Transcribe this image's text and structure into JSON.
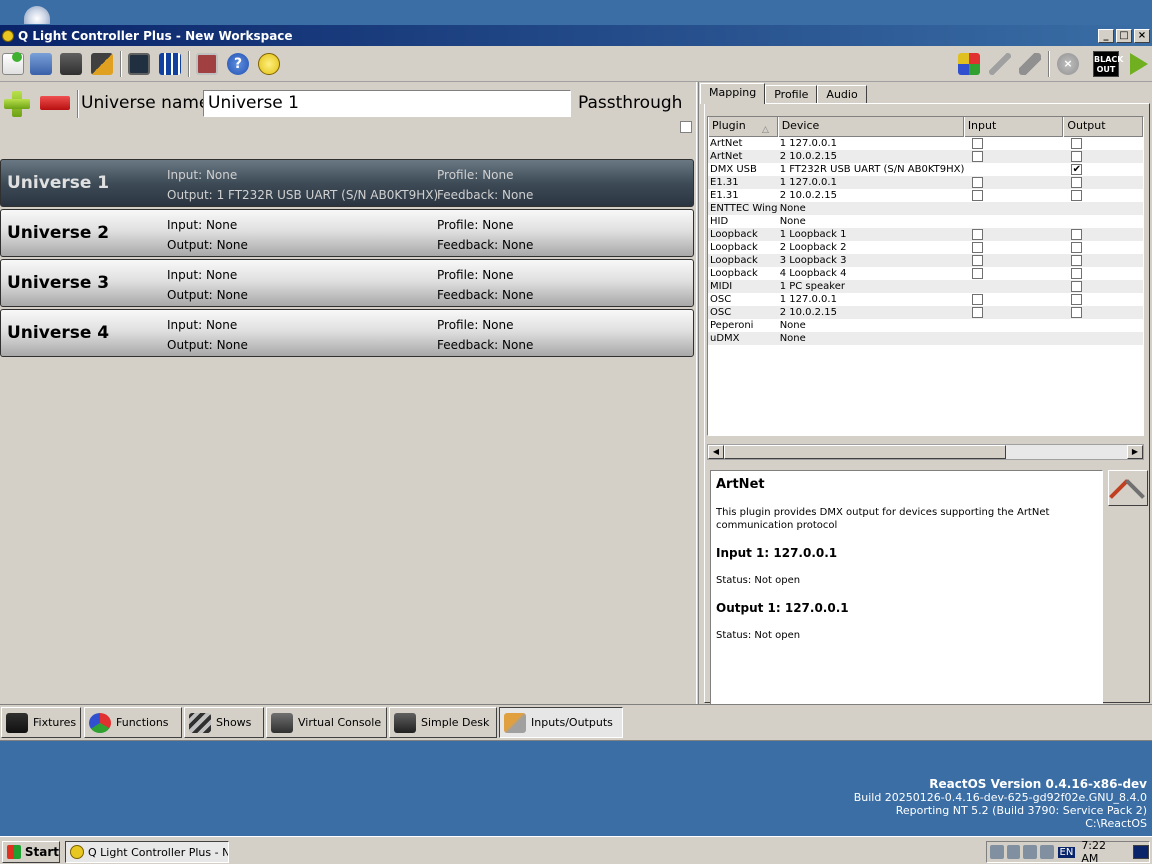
{
  "window": {
    "title": "Q Light Controller Plus - New Workspace"
  },
  "toolbar": {
    "left_icons": [
      "new-workspace-icon",
      "open-icon",
      "save-icon",
      "save-as-icon",
      "monitor-icon",
      "address-tool-icon",
      "dump-icon",
      "help-icon",
      "about-icon"
    ],
    "right_icons": [
      "fixture-edit-icon",
      "fade-icon",
      "stop-icon",
      "black-out",
      "play-icon"
    ],
    "blackout_label_1": "BLACK",
    "blackout_label_2": "OUT"
  },
  "universe_toolbar": {
    "name_label": "Universe name:",
    "name_value": "Universe 1",
    "passthrough_label": "Passthrough"
  },
  "universes": [
    {
      "name": "Universe 1",
      "input_label": "Input:",
      "input": "None",
      "output_label": "Output:",
      "output": "1 FT232R USB UART (S/N AB0KT9HX)",
      "profile_label": "Profile:",
      "profile": "None",
      "feedback_label": "Feedback:",
      "feedback": "None",
      "selected": true
    },
    {
      "name": "Universe 2",
      "input_label": "Input:",
      "input": "None",
      "output_label": "Output:",
      "output": "None",
      "profile_label": "Profile:",
      "profile": "None",
      "feedback_label": "Feedback:",
      "feedback": "None",
      "selected": false
    },
    {
      "name": "Universe 3",
      "input_label": "Input:",
      "input": "None",
      "output_label": "Output:",
      "output": "None",
      "profile_label": "Profile:",
      "profile": "None",
      "feedback_label": "Feedback:",
      "feedback": "None",
      "selected": false
    },
    {
      "name": "Universe 4",
      "input_label": "Input:",
      "input": "None",
      "output_label": "Output:",
      "output": "None",
      "profile_label": "Profile:",
      "profile": "None",
      "feedback_label": "Feedback:",
      "feedback": "None",
      "selected": false
    }
  ],
  "right_tabs": [
    {
      "label": "Mapping",
      "active": true
    },
    {
      "label": "Profile",
      "active": false
    },
    {
      "label": "Audio",
      "active": false
    }
  ],
  "mapping": {
    "headers": [
      "Plugin",
      "Device",
      "Input",
      "Output"
    ],
    "rows": [
      {
        "plugin": "ArtNet",
        "device": "1  127.0.0.1",
        "input": "unchecked",
        "output": "unchecked"
      },
      {
        "plugin": "ArtNet",
        "device": "2  10.0.2.15",
        "input": "unchecked",
        "output": "unchecked"
      },
      {
        "plugin": "DMX USB",
        "device": "1  FT232R USB UART (S/N AB0KT9HX)",
        "input": "",
        "output": "checked"
      },
      {
        "plugin": "E1.31",
        "device": "1  127.0.0.1",
        "input": "unchecked",
        "output": "unchecked"
      },
      {
        "plugin": "E1.31",
        "device": "2  10.0.2.15",
        "input": "unchecked",
        "output": "unchecked"
      },
      {
        "plugin": "ENTTEC Wing",
        "device": "None",
        "input": "",
        "output": ""
      },
      {
        "plugin": "HID",
        "device": "None",
        "input": "",
        "output": ""
      },
      {
        "plugin": "Loopback",
        "device": "1  Loopback 1",
        "input": "unchecked",
        "output": "unchecked"
      },
      {
        "plugin": "Loopback",
        "device": "2  Loopback 2",
        "input": "unchecked",
        "output": "unchecked"
      },
      {
        "plugin": "Loopback",
        "device": "3  Loopback 3",
        "input": "unchecked",
        "output": "unchecked"
      },
      {
        "plugin": "Loopback",
        "device": "4  Loopback 4",
        "input": "unchecked",
        "output": "unchecked"
      },
      {
        "plugin": "MIDI",
        "device": "1  PC speaker",
        "input": "",
        "output": "unchecked"
      },
      {
        "plugin": "OSC",
        "device": "1  127.0.0.1",
        "input": "unchecked",
        "output": "unchecked"
      },
      {
        "plugin": "OSC",
        "device": "2  10.0.2.15",
        "input": "unchecked",
        "output": "unchecked"
      },
      {
        "plugin": "Peperoni",
        "device": "None",
        "input": "",
        "output": ""
      },
      {
        "plugin": "uDMX",
        "device": "None",
        "input": "",
        "output": ""
      }
    ],
    "check_mark": "✔"
  },
  "info": {
    "title": "ArtNet",
    "description": "This plugin provides DMX output for devices supporting the ArtNet communication protocol",
    "input_heading": "Input 1: 127.0.0.1",
    "input_status": "Status: Not open",
    "output_heading": "Output 1: 127.0.0.1",
    "output_status": "Status: Not open"
  },
  "bottom_tabs": [
    {
      "label": "Fixtures",
      "icon": "fixtures-icon",
      "active": false
    },
    {
      "label": "Functions",
      "icon": "functions-icon",
      "active": false
    },
    {
      "label": "Shows",
      "icon": "shows-icon",
      "active": false
    },
    {
      "label": "Virtual Console",
      "icon": "virtual-console-icon",
      "active": false
    },
    {
      "label": "Simple Desk",
      "icon": "simple-desk-icon",
      "active": false
    },
    {
      "label": "Inputs/Outputs",
      "icon": "inputs-outputs-icon",
      "active": true
    }
  ],
  "reactos": {
    "version": "ReactOS Version 0.4.16-x86-dev",
    "build": "Build 20250126-0.4.16-dev-625-gd92f02e.GNU_8.4.0",
    "reporting": "Reporting NT 5.2 (Build 3790: Service Pack 2)",
    "path": "C:\\ReactOS"
  },
  "taskbar": {
    "start_label": "Start",
    "task_label": "Q Light Controller Plus - Ne...",
    "lang": "EN",
    "clock": "7:22 AM"
  },
  "colors": {
    "titlebar": "#0a246a",
    "desktop": "#3a6ea5",
    "selected_universe": "#3e4c58"
  }
}
